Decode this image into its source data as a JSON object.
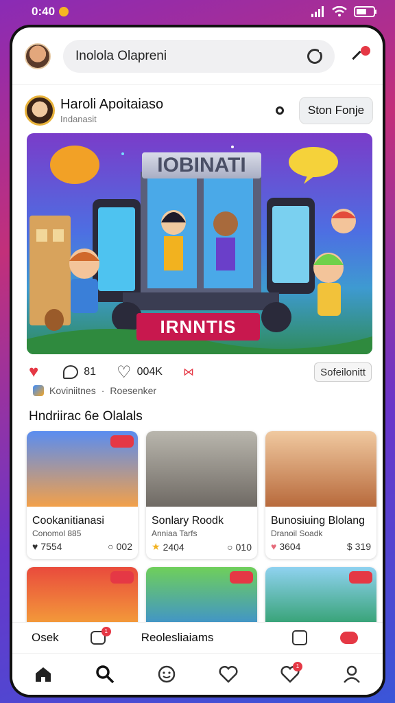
{
  "status_bar": {
    "time": "0:40",
    "battery_pct": 60
  },
  "topbar": {
    "search_text": "Inolola Olapreni"
  },
  "post": {
    "author": "Haroli Apoitaiaso",
    "location": "Indanasit",
    "follow_label": "Ston Fonje",
    "hero_title": "IOBINATI",
    "hero_banner": "IRNNTIS",
    "comments": "81",
    "likes": "004K",
    "save_label": "Sofeilonitt",
    "meta_left": "Koviniitnes",
    "meta_right": "Roesenker"
  },
  "section": {
    "title": "Hndriirac 6e Olalals"
  },
  "cards": [
    {
      "title": "Cookanitianasi",
      "sub": "Conomol 885",
      "left_stat": "7554",
      "right_stat": "002",
      "badge": "",
      "bg_top": "#5a8df0",
      "bg_bottom": "#f2a04a"
    },
    {
      "title": "Sonlary Roodk",
      "sub": "Anniaa Tarfs",
      "left_stat": "2404",
      "right_stat": "010",
      "badge": "",
      "bg_top": "#b9b6ad",
      "bg_bottom": "#6f6a64"
    },
    {
      "title": "Bunosiuing Blolang",
      "sub": "Dranoil Soadk",
      "left_stat": "3604",
      "right_stat": "319",
      "badge": "",
      "bg_top": "#f0c9a0",
      "bg_bottom": "#b86a3c"
    },
    {
      "title": "",
      "sub": "",
      "left_stat": "",
      "right_stat": "",
      "badge": "",
      "bg_top": "#e94b3c",
      "bg_bottom": "#f4a23a"
    },
    {
      "title": "",
      "sub": "",
      "left_stat": "",
      "right_stat": "",
      "badge": "",
      "bg_top": "#6fcf5a",
      "bg_bottom": "#3d8fd2"
    },
    {
      "title": "",
      "sub": "",
      "left_stat": "",
      "right_stat": "",
      "badge": "",
      "bg_top": "#8fd2f0",
      "bg_bottom": "#2f9e6b"
    }
  ],
  "context_bar": {
    "left_label": "Osek",
    "chat_badge": "1",
    "center_label": "Reolesliaiams"
  },
  "bottom_nav": {
    "favorites_badge": "1"
  },
  "colors": {
    "accent": "#e53845"
  }
}
